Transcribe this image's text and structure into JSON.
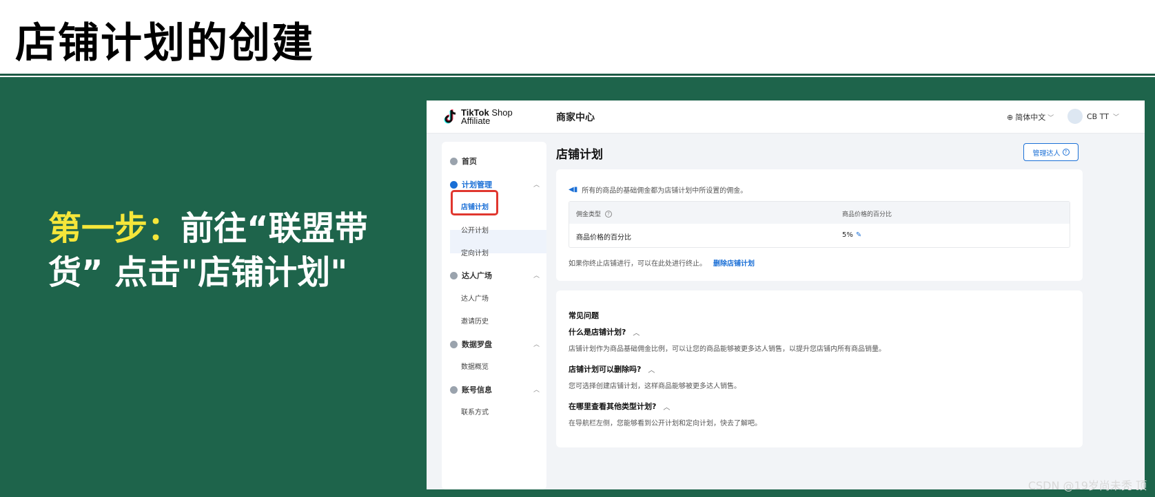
{
  "slide": {
    "title": "店铺计划的创建",
    "step_prefix": "第一步：",
    "step_text": "前往“联盟带货” 点击\"店铺计划\"",
    "watermark": "CSDN @19岁尚未秃 顶"
  },
  "app": {
    "logo_line1": "TikTok",
    "logo_shop": "Shop",
    "logo_line2": "Affiliate",
    "merchant_center": "商家中心",
    "language": "简体中文",
    "user": "CB TT"
  },
  "sidebar": {
    "items": [
      {
        "label": "首页"
      },
      {
        "label": "计划管理"
      },
      {
        "label": "店铺计划"
      },
      {
        "label": "公开计划"
      },
      {
        "label": "定向计划"
      },
      {
        "label": "达人广场"
      },
      {
        "label": "达人广场"
      },
      {
        "label": "邀请历史"
      },
      {
        "label": "数据罗盘"
      },
      {
        "label": "数据概览"
      },
      {
        "label": "账号信息"
      },
      {
        "label": "联系方式"
      }
    ]
  },
  "main": {
    "page_title": "店铺计划",
    "manage_button": "管理达人",
    "notice": "所有的商品的基础佣金都为店铺计划中所设置的佣金。",
    "table": {
      "headers": [
        "佣金类型",
        "商品价格的百分比"
      ],
      "row": [
        "商品价格的百分比",
        "5%"
      ]
    },
    "end_note": "如果你终止店铺进行，可以在此处进行终止。",
    "delete_link": "删除店铺计划"
  },
  "faq": {
    "title": "常见问题",
    "items": [
      {
        "q": "什么是店铺计划?",
        "a": "店铺计划作为商品基础佣金比例，可以让您的商品能够被更多达人销售，以提升您店铺内所有商品销量。"
      },
      {
        "q": "店铺计划可以删除吗?",
        "a": "您可选择创建店铺计划，这样商品能够被更多达人销售。"
      },
      {
        "q": "在哪里查看其他类型计划?",
        "a": "在导航栏左侧，您能够看到公开计划和定向计划，快去了解吧。"
      }
    ]
  },
  "colors": {
    "green_bg": "#1e644b",
    "accent_yellow": "#f5e63a",
    "link_blue": "#1a6fd6",
    "highlight_red": "#e0362e"
  }
}
